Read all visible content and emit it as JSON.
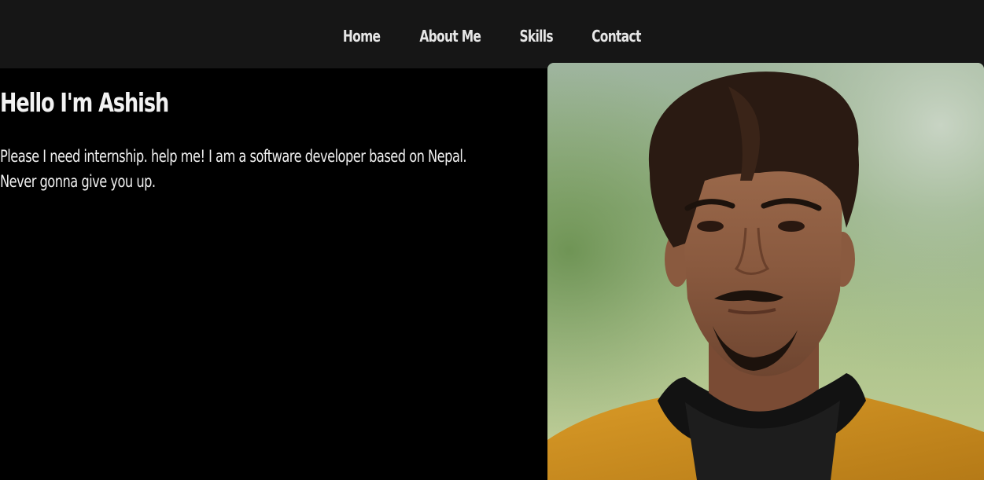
{
  "nav": {
    "items": [
      {
        "label": "Home"
      },
      {
        "label": "About Me"
      },
      {
        "label": "Skills"
      },
      {
        "label": "Contact"
      }
    ]
  },
  "hero": {
    "heading": "Hello I'm Ashish",
    "description": "Please I need internship. help me! I am a software developer based on Nepal. Never gonna give you up."
  },
  "colors": {
    "navbar_bg": "#161616",
    "page_bg": "#000000",
    "nav_text": "#e6e6e6",
    "hero_text": "#f2f2f2"
  }
}
